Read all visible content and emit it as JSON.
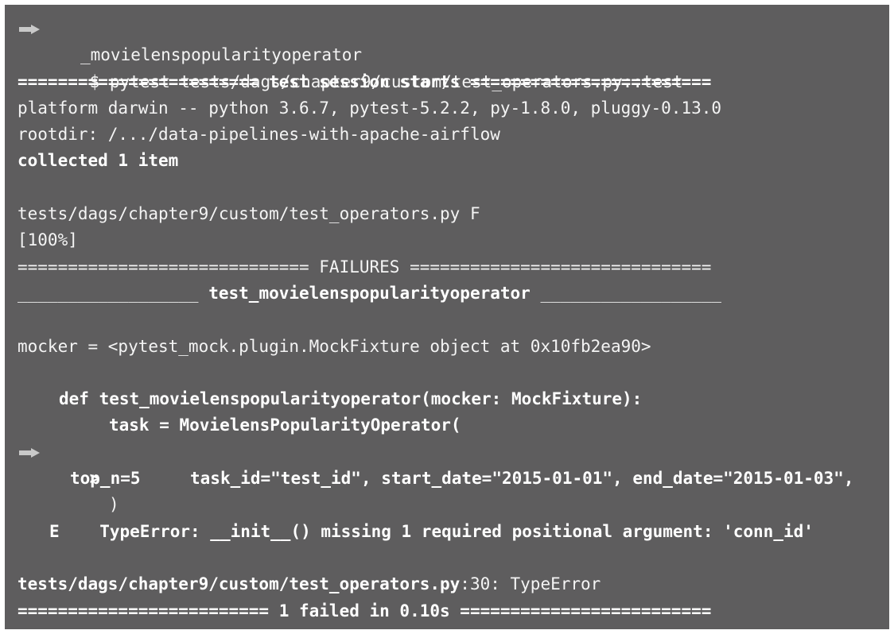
{
  "terminal": {
    "prompt": "$",
    "command_line1": "pytest tests/dags/chapter9/custom/test_operators.py::test",
    "command_line2": "_movielenspopularityoperator",
    "session_header": "======================== test session starts ========================",
    "platform": "platform darwin -- python 3.6.7, pytest-5.2.2, py-1.8.0, pluggy-0.13.0",
    "rootdir": "rootdir: /.../data-pipelines-with-apache-airflow",
    "collected": "collected 1 item",
    "test_file_result": "tests/dags/chapter9/custom/test_operators.py F",
    "percent": "[100%]",
    "failures_header": "============================= FAILURES ==============================",
    "test_name_left": "__________________",
    "test_name": "test_movielenspopularityoperator",
    "test_name_right": "__________________",
    "mocker": "mocker = <pytest_mock.plugin.MockFixture object at 0x10fb2ea90>",
    "def_line": "def test_movielenspopularityoperator(mocker: MockFixture):",
    "task_line": "task = MovielensPopularityOperator(",
    "marker": ">",
    "args_line": "         task_id=\"test_id\", start_date=\"2015-01-01\", end_date=\"2015-01-03\",",
    "topn_line": "top_n=5",
    "close_paren": ")",
    "error_marker": "E",
    "error_text": "    TypeError: __init__() missing 1 required positional argument: 'conn_id'",
    "loc_file": "tests/dags/chapter9/custom/test_operators.py",
    "loc_rest": ":30: TypeError",
    "summary": "========================= 1 failed in 0.10s ========================="
  },
  "icons": {
    "prompt_arrow": "arrow-right-icon",
    "line_arrow": "arrow-right-icon"
  },
  "colors": {
    "background": "#5e5d5e",
    "text": "#f4f4f4",
    "arrow": "#c9c9c9"
  }
}
